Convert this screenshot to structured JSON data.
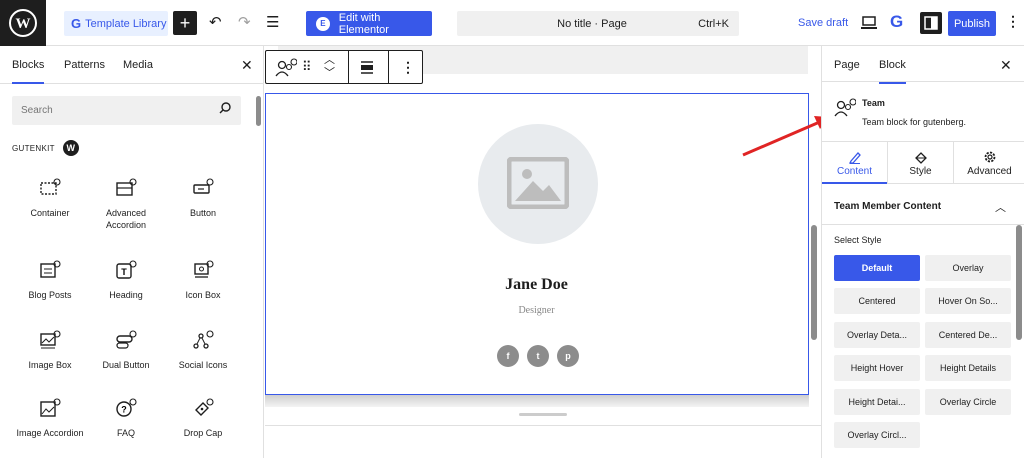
{
  "topbar": {
    "template_library": "Template Library",
    "edit_elementor": "Edit with Elementor",
    "document_title": "No title · Page",
    "shortcut": "Ctrl+K",
    "save_draft": "Save draft",
    "publish": "Publish"
  },
  "left": {
    "tabs": [
      "Blocks",
      "Patterns",
      "Media"
    ],
    "search_placeholder": "Search",
    "category": "GUTENKIT",
    "blocks": [
      {
        "label": "Container",
        "icon": "container-icon"
      },
      {
        "label": "Advanced Accordion",
        "icon": "accordion-icon"
      },
      {
        "label": "Button",
        "icon": "button-icon"
      },
      {
        "label": "Blog Posts",
        "icon": "blog-posts-icon"
      },
      {
        "label": "Heading",
        "icon": "heading-icon"
      },
      {
        "label": "Icon Box",
        "icon": "icon-box-icon"
      },
      {
        "label": "Image Box",
        "icon": "image-box-icon"
      },
      {
        "label": "Dual Button",
        "icon": "dual-button-icon"
      },
      {
        "label": "Social Icons",
        "icon": "social-icons-icon"
      },
      {
        "label": "Image Accordion",
        "icon": "image-accordion-icon"
      },
      {
        "label": "FAQ",
        "icon": "faq-icon"
      },
      {
        "label": "Drop Cap",
        "icon": "drop-cap-icon"
      }
    ]
  },
  "canvas": {
    "member_name": "Jane Doe",
    "member_role": "Designer",
    "social": [
      "f",
      "t",
      "p"
    ]
  },
  "right": {
    "tabs": [
      "Page",
      "Block"
    ],
    "block_title": "Team",
    "block_desc": "Team block for gutenberg.",
    "subtabs": [
      "Content",
      "Style",
      "Advanced"
    ],
    "section_title": "Team Member Content",
    "select_style_label": "Select Style",
    "styles": [
      "Default",
      "Overlay",
      "Centered",
      "Hover On So...",
      "Overlay Deta...",
      "Centered De...",
      "Height Hover",
      "Height Details",
      "Height Detai...",
      "Overlay Circle",
      "Overlay Circl..."
    ],
    "active_style": "Default"
  },
  "colors": {
    "accent": "#3858e9",
    "dark": "#1e1e1e",
    "annotation_arrow": "#e02424"
  }
}
